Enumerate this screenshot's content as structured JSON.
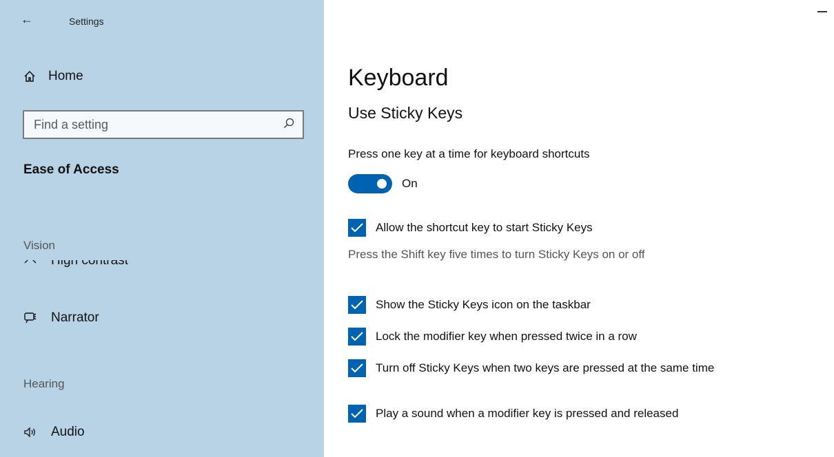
{
  "window": {
    "back_glyph": "←",
    "title": "Settings"
  },
  "sidebar": {
    "home_label": "Home",
    "search_placeholder": "Find a setting",
    "section_heading": "Ease of Access",
    "group_vision": "Vision",
    "item_high_contrast": "High contrast",
    "item_narrator": "Narrator",
    "group_hearing": "Hearing",
    "item_audio": "Audio"
  },
  "main": {
    "title": "Keyboard",
    "subtitle": "Use Sticky Keys",
    "toggle_description": "Press one key at a time for keyboard shortcuts",
    "toggle_state": "On",
    "checkboxes": [
      {
        "label": "Allow the shortcut key to start Sticky Keys",
        "checked": true
      },
      {
        "label": "Show the Sticky Keys icon on the taskbar",
        "checked": true
      },
      {
        "label": "Lock the modifier key when pressed twice in a row",
        "checked": true
      },
      {
        "label": "Turn off Sticky Keys when two keys are pressed at the same time",
        "checked": true
      },
      {
        "label": "Play a sound when a modifier key is pressed and released",
        "checked": true
      }
    ],
    "shortcut_hint": "Press the Shift key five times to turn Sticky Keys on or off"
  },
  "colors": {
    "sidebar_bg": "#b8d3e6",
    "accent": "#0063b1"
  },
  "icons": [
    "back-arrow-icon",
    "home-icon",
    "search-icon",
    "high-contrast-icon",
    "narrator-icon",
    "audio-icon",
    "minimize-icon",
    "checkmark-icon"
  ]
}
